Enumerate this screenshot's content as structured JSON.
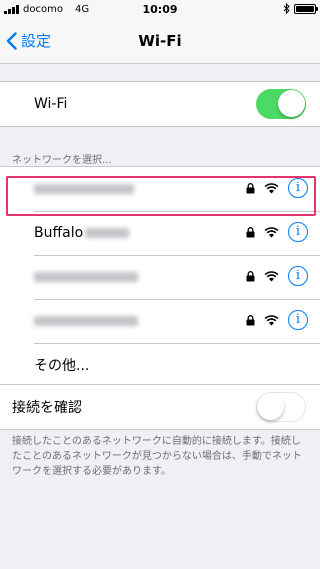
{
  "status_bar": {
    "carrier": "docomo",
    "network": "4G",
    "time": "10:09",
    "battery_level": 1.0
  },
  "nav": {
    "back_label": "設定",
    "title": "Wi-Fi"
  },
  "wifi_toggle": {
    "label": "Wi-Fi",
    "state": "on",
    "color": "#4cd964"
  },
  "networks": {
    "header": "ネットワークを選択...",
    "items": [
      {
        "name": "",
        "secured": true,
        "signal": "wifi-icon"
      },
      {
        "name": "Buffalo",
        "secured": true,
        "signal": "wifi-icon",
        "highlighted": true,
        "highlight_color": "#e6326e"
      },
      {
        "name": "",
        "secured": true,
        "signal": "wifi-icon"
      },
      {
        "name": "",
        "secured": true,
        "signal": "wifi-icon"
      }
    ],
    "other_label": "その他..."
  },
  "ask_join": {
    "label": "接続を確認",
    "state": "off",
    "footer": "接続したことのあるネットワークに自動的に接続します。接続したことのあるネットワークが見つからない場合は、手動でネットワークを選択する必要があります。"
  },
  "colors": {
    "accent": "#007aff",
    "background": "#efeff4"
  }
}
